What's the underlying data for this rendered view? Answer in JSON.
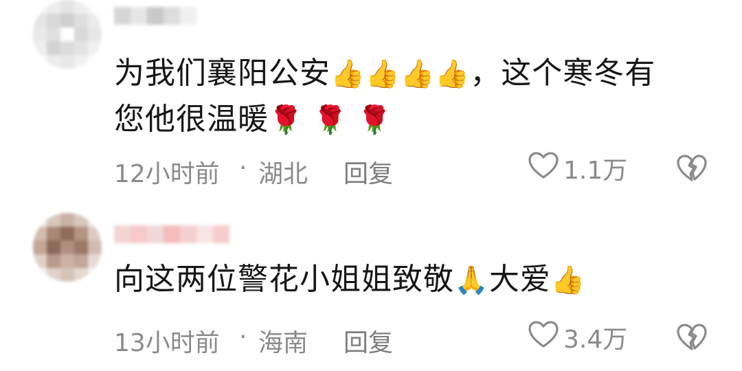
{
  "comments": [
    {
      "text": "为我们襄阳公安",
      "text_emojis": "👍👍👍👍",
      "text_after": "，这个寒冬有",
      "text_line2": "您他很温暖",
      "text_line2_emojis": "🌹 🌹 🌹",
      "time": "12小时前",
      "dot": "·",
      "location": "湖北",
      "reply": "回复",
      "likes": "1.1万"
    },
    {
      "text": "向这两位警花小姐姐致敬",
      "text_emoji1": "🙏",
      "text_mid": "大爱",
      "text_emoji2": "👍",
      "time": "13小时前",
      "dot": "·",
      "location": "海南",
      "reply": "回复",
      "likes": "3.4万"
    }
  ],
  "icons": {
    "like": "heart-outline-icon",
    "dislike": "broken-heart-icon"
  },
  "colors": {
    "text": "#161616",
    "meta": "#8a8a8a"
  }
}
